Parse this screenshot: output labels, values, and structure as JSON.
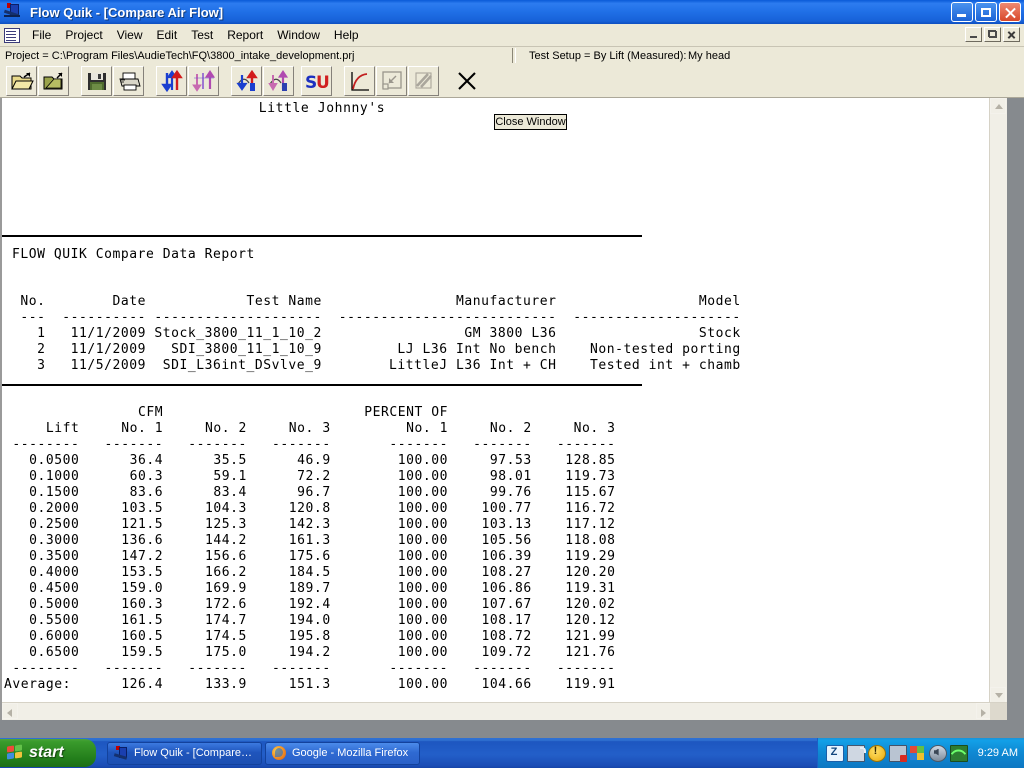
{
  "window": {
    "title": "Flow Quik - [Compare Air Flow]",
    "icon": "flowquik-app-icon",
    "controls": {
      "minimize": "minimize",
      "maximize": "restore",
      "close": "close"
    },
    "mdi_controls": {
      "minimize": "minimize",
      "maximize": "restore",
      "close": "close"
    }
  },
  "menu": {
    "doc_icon": "document-grid-icon",
    "items": [
      "File",
      "Project",
      "View",
      "Edit",
      "Test",
      "Report",
      "Window",
      "Help"
    ]
  },
  "infobar": {
    "project": "Project = C:\\Program Files\\AudieTech\\FQ\\3800_intake_development.prj",
    "test_setup_label": "Test Setup =  By Lift (Measured):",
    "test_setup_value": "My head"
  },
  "toolbar": {
    "buttons": [
      {
        "name": "open-project-icon",
        "label": "Open Project"
      },
      {
        "name": "open-test-icon",
        "label": "Open Test"
      },
      {
        "name": "save-icon",
        "label": "Save"
      },
      {
        "name": "print-icon",
        "label": "Print"
      },
      {
        "name": "flow-test-icon",
        "label": "Flow Test"
      },
      {
        "name": "flow-test-alt-icon",
        "label": "Flow Test Alt"
      },
      {
        "name": "intake-test-icon",
        "label": "Intake Test"
      },
      {
        "name": "intake-test-alt-icon",
        "label": "Intake Test Alt"
      },
      {
        "name": "su-icon",
        "label": "SU"
      },
      {
        "name": "curve-graph-icon",
        "label": "Graph"
      },
      {
        "name": "zoom-region-icon",
        "label": "Zoom Region"
      },
      {
        "name": "hatch-icon",
        "label": "Hatch"
      },
      {
        "name": "close-x-icon",
        "label": "Close"
      }
    ]
  },
  "report": {
    "header_title": "Little Johnny's",
    "close_window_button": "Close Window",
    "report_label": "FLOW QUIK Compare Data Report",
    "tests": {
      "headers": [
        "No.",
        "Date",
        "Test Name",
        "Manufacturer",
        "Model"
      ],
      "underline": "---  ----------  -------------------  --------------------------  --------------------",
      "rows": [
        {
          "no": "1",
          "date": "11/1/2009",
          "test_name": "Stock_3800_11_1_10_2",
          "manufacturer": "GM 3800 L36",
          "model": "Stock"
        },
        {
          "no": "2",
          "date": "11/1/2009",
          "test_name": "SDI_3800_11_1_10_9",
          "manufacturer": "LJ L36 Int No bench",
          "model": "Non-tested porting"
        },
        {
          "no": "3",
          "date": "11/5/2009",
          "test_name": "SDI_L36int_DSvlve_9",
          "manufacturer": "LittleJ L36 Int + CH",
          "model": "Tested int + chamb"
        }
      ]
    },
    "data_table": {
      "group_headers": [
        "CFM",
        "PERCENT OF"
      ],
      "column_headers": [
        "Lift",
        "No. 1",
        "No. 2",
        "No. 3",
        "No. 1",
        "No. 2",
        "No. 3"
      ],
      "rule": "--------   -------   -------   -------      -------   -------   -------",
      "rows": [
        {
          "lift": "0.0500",
          "cfm1": "36.4",
          "cfm2": "35.5",
          "cfm3": "46.9",
          "pct1": "100.00",
          "pct2": "97.53",
          "pct3": "128.85"
        },
        {
          "lift": "0.1000",
          "cfm1": "60.3",
          "cfm2": "59.1",
          "cfm3": "72.2",
          "pct1": "100.00",
          "pct2": "98.01",
          "pct3": "119.73"
        },
        {
          "lift": "0.1500",
          "cfm1": "83.6",
          "cfm2": "83.4",
          "cfm3": "96.7",
          "pct1": "100.00",
          "pct2": "99.76",
          "pct3": "115.67"
        },
        {
          "lift": "0.2000",
          "cfm1": "103.5",
          "cfm2": "104.3",
          "cfm3": "120.8",
          "pct1": "100.00",
          "pct2": "100.77",
          "pct3": "116.72"
        },
        {
          "lift": "0.2500",
          "cfm1": "121.5",
          "cfm2": "125.3",
          "cfm3": "142.3",
          "pct1": "100.00",
          "pct2": "103.13",
          "pct3": "117.12"
        },
        {
          "lift": "0.3000",
          "cfm1": "136.6",
          "cfm2": "144.2",
          "cfm3": "161.3",
          "pct1": "100.00",
          "pct2": "105.56",
          "pct3": "118.08"
        },
        {
          "lift": "0.3500",
          "cfm1": "147.2",
          "cfm2": "156.6",
          "cfm3": "175.6",
          "pct1": "100.00",
          "pct2": "106.39",
          "pct3": "119.29"
        },
        {
          "lift": "0.4000",
          "cfm1": "153.5",
          "cfm2": "166.2",
          "cfm3": "184.5",
          "pct1": "100.00",
          "pct2": "108.27",
          "pct3": "120.20"
        },
        {
          "lift": "0.4500",
          "cfm1": "159.0",
          "cfm2": "169.9",
          "cfm3": "189.7",
          "pct1": "100.00",
          "pct2": "106.86",
          "pct3": "119.31"
        },
        {
          "lift": "0.5000",
          "cfm1": "160.3",
          "cfm2": "172.6",
          "cfm3": "192.4",
          "pct1": "100.00",
          "pct2": "107.67",
          "pct3": "120.02"
        },
        {
          "lift": "0.5500",
          "cfm1": "161.5",
          "cfm2": "174.7",
          "cfm3": "194.0",
          "pct1": "100.00",
          "pct2": "108.17",
          "pct3": "120.12"
        },
        {
          "lift": "0.6000",
          "cfm1": "160.5",
          "cfm2": "174.5",
          "cfm3": "195.8",
          "pct1": "100.00",
          "pct2": "108.72",
          "pct3": "121.99"
        },
        {
          "lift": "0.6500",
          "cfm1": "159.5",
          "cfm2": "175.0",
          "cfm3": "194.2",
          "pct1": "100.00",
          "pct2": "109.72",
          "pct3": "121.76"
        }
      ],
      "average": {
        "label": "Average:",
        "cfm1": "126.4",
        "cfm2": "133.9",
        "cfm3": "151.3",
        "pct1": "100.00",
        "pct2": "104.66",
        "pct3": "119.91"
      }
    }
  },
  "taskbar": {
    "start_label": "start",
    "tasks": [
      {
        "icon": "flowquik-taskbar-icon",
        "label": "Flow Quik - [Compare…",
        "active": true
      },
      {
        "icon": "firefox-icon",
        "label": "Google - Mozilla Firefox",
        "active": false
      }
    ],
    "tray_icons": [
      "zonealarm-icon",
      "network-icon",
      "warning-icon",
      "network-disconnected-icon",
      "security-center-icon",
      "volume-icon",
      "wireless-signal-icon"
    ],
    "clock": "9:29 AM"
  },
  "chart_data": {
    "type": "table",
    "title": "FLOW QUIK Compare Data Report",
    "xlabel": "Lift",
    "ylabel": "CFM",
    "categories": [
      "0.0500",
      "0.1000",
      "0.1500",
      "0.2000",
      "0.2500",
      "0.3000",
      "0.3500",
      "0.4000",
      "0.4500",
      "0.5000",
      "0.5500",
      "0.6000",
      "0.6500"
    ],
    "series": [
      {
        "name": "CFM No. 1",
        "values": [
          36.4,
          60.3,
          83.6,
          103.5,
          121.5,
          136.6,
          147.2,
          153.5,
          159.0,
          160.3,
          161.5,
          160.5,
          159.5
        ]
      },
      {
        "name": "CFM No. 2",
        "values": [
          35.5,
          59.1,
          83.4,
          104.3,
          125.3,
          144.2,
          156.6,
          166.2,
          169.9,
          172.6,
          174.7,
          174.5,
          175.0
        ]
      },
      {
        "name": "CFM No. 3",
        "values": [
          46.9,
          72.2,
          96.7,
          120.8,
          142.3,
          161.3,
          175.6,
          184.5,
          189.7,
          192.4,
          194.0,
          195.8,
          194.2
        ]
      },
      {
        "name": "PERCENT OF No. 1",
        "values": [
          100.0,
          100.0,
          100.0,
          100.0,
          100.0,
          100.0,
          100.0,
          100.0,
          100.0,
          100.0,
          100.0,
          100.0,
          100.0
        ]
      },
      {
        "name": "PERCENT OF No. 2",
        "values": [
          97.53,
          98.01,
          99.76,
          100.77,
          103.13,
          105.56,
          106.39,
          108.27,
          106.86,
          107.67,
          108.17,
          108.72,
          109.72
        ]
      },
      {
        "name": "PERCENT OF No. 3",
        "values": [
          128.85,
          119.73,
          115.67,
          116.72,
          117.12,
          118.08,
          119.29,
          120.2,
          119.31,
          120.02,
          120.12,
          121.99,
          121.76
        ]
      }
    ],
    "averages": {
      "CFM No. 1": 126.4,
      "CFM No. 2": 133.9,
      "CFM No. 3": 151.3,
      "PERCENT OF No. 1": 100.0,
      "PERCENT OF No. 2": 104.66,
      "PERCENT OF No. 3": 119.91
    }
  }
}
